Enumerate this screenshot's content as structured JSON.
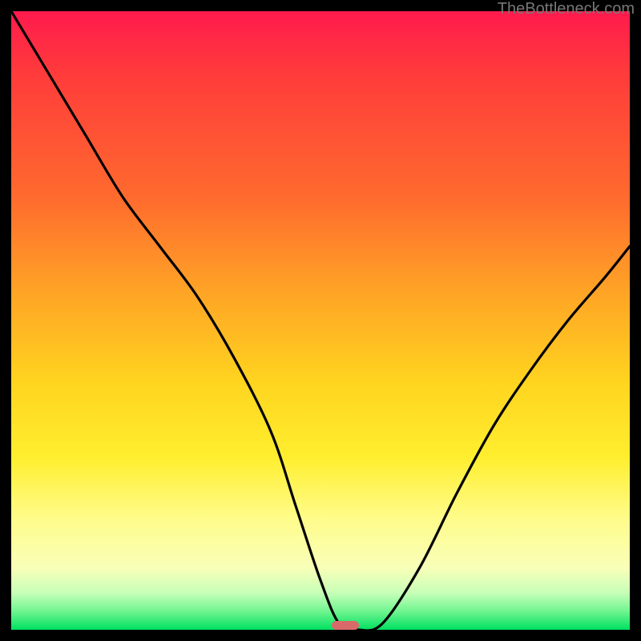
{
  "watermark": {
    "text": "TheBottleneck.com"
  },
  "chart_data": {
    "type": "line",
    "title": "",
    "xlabel": "",
    "ylabel": "",
    "xlim": [
      0,
      100
    ],
    "ylim": [
      0,
      100
    ],
    "series": [
      {
        "name": "bottleneck-curve",
        "x": [
          0,
          6,
          12,
          18,
          24,
          30,
          36,
          42,
          46,
          50,
          53,
          56,
          60,
          66,
          72,
          78,
          84,
          90,
          96,
          100
        ],
        "y": [
          100,
          90,
          80,
          70,
          62,
          54,
          44,
          32,
          20,
          8,
          1,
          0,
          1,
          10,
          22,
          33,
          42,
          50,
          57,
          62
        ]
      }
    ],
    "marker": {
      "x_center": 54,
      "y": 0,
      "width_pct": 4.5,
      "color": "#d96a6a"
    },
    "gradient_stops": [
      {
        "pct": 0,
        "color": "#ff1a4d"
      },
      {
        "pct": 10,
        "color": "#ff3b3b"
      },
      {
        "pct": 30,
        "color": "#ff6a2e"
      },
      {
        "pct": 46,
        "color": "#ffa625"
      },
      {
        "pct": 60,
        "color": "#ffd41f"
      },
      {
        "pct": 72,
        "color": "#ffee2e"
      },
      {
        "pct": 82,
        "color": "#fffc8a"
      },
      {
        "pct": 90,
        "color": "#f8ffb8"
      },
      {
        "pct": 94,
        "color": "#c8ffb8"
      },
      {
        "pct": 97,
        "color": "#70f590"
      },
      {
        "pct": 100,
        "color": "#00e060"
      }
    ]
  }
}
